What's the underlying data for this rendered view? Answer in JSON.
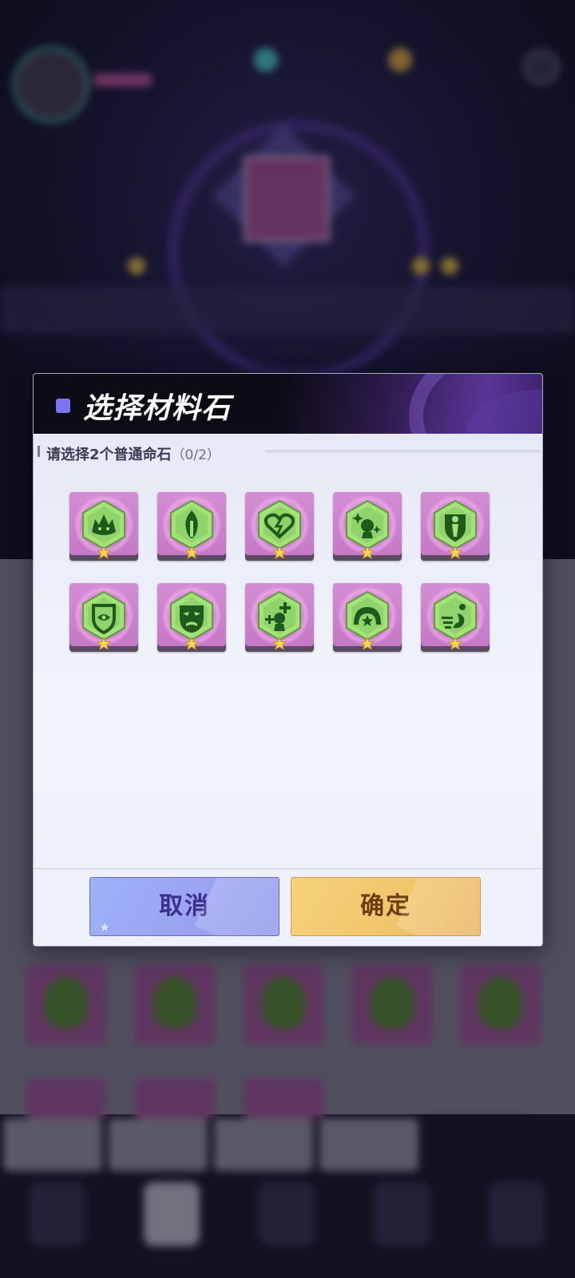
{
  "dialog": {
    "title": "选择材料石",
    "subtitle": "请选择2个普通命石",
    "selection_count": "（0/2）",
    "cancel_label": "取消",
    "confirm_label": "确定"
  },
  "stones": [
    {
      "icon": "beast-head-icon",
      "stars": 1
    },
    {
      "icon": "flame-sword-icon",
      "stars": 1
    },
    {
      "icon": "broken-heart-lightning-icon",
      "stars": 1
    },
    {
      "icon": "sparkle-figure-icon",
      "stars": 1
    },
    {
      "icon": "shield-warrior-icon",
      "stars": 1
    },
    {
      "icon": "shield-eye-icon",
      "stars": 1
    },
    {
      "icon": "mask-icon",
      "stars": 1
    },
    {
      "icon": "healer-plus-icon",
      "stars": 1
    },
    {
      "icon": "helmet-stars-icon",
      "stars": 1
    },
    {
      "icon": "dash-speed-icon",
      "stars": 1
    }
  ],
  "colors": {
    "accent": "#7a74f2",
    "stone_frame": "#c376c4",
    "stone_gem": "#8fd46a",
    "cancel": "#9aa2f2",
    "confirm": "#f1c46a"
  }
}
